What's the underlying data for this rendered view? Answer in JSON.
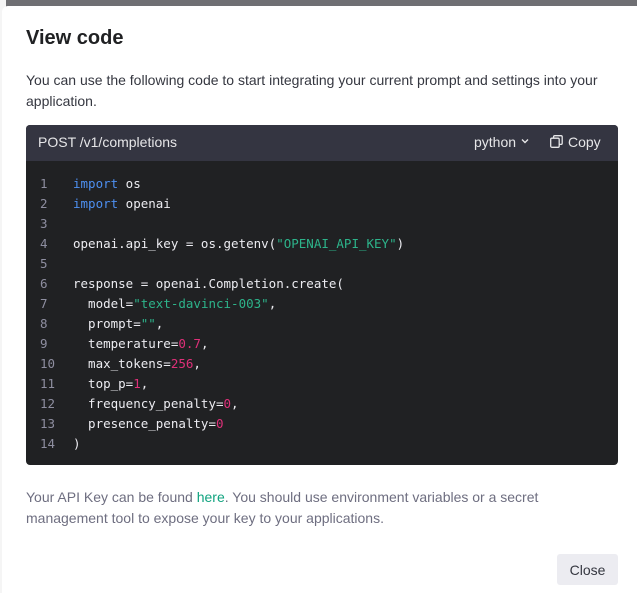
{
  "modal": {
    "title": "View code",
    "intro": "You can use the following code to start integrating your current prompt and settings into your application.",
    "footer_before": "Your API Key can be found ",
    "footer_link": "here",
    "footer_after": ". You should use environment variables or a secret management tool to expose your key to your applications.",
    "close_label": "Close"
  },
  "code_panel": {
    "endpoint": "POST /v1/completions",
    "language": "python",
    "copy_label": "Copy",
    "lines": [
      {
        "n": "1",
        "segs": [
          {
            "t": "import",
            "c": "kw"
          },
          {
            "t": " os",
            "c": ""
          }
        ]
      },
      {
        "n": "2",
        "segs": [
          {
            "t": "import",
            "c": "kw"
          },
          {
            "t": " openai",
            "c": ""
          }
        ]
      },
      {
        "n": "3",
        "segs": []
      },
      {
        "n": "4",
        "segs": [
          {
            "t": "openai.api_key = os.getenv(",
            "c": ""
          },
          {
            "t": "\"OPENAI_API_KEY\"",
            "c": "str"
          },
          {
            "t": ")",
            "c": ""
          }
        ]
      },
      {
        "n": "5",
        "segs": []
      },
      {
        "n": "6",
        "segs": [
          {
            "t": "response = openai.Completion.create(",
            "c": ""
          }
        ]
      },
      {
        "n": "7",
        "segs": [
          {
            "t": "  model=",
            "c": ""
          },
          {
            "t": "\"text-davinci-003\"",
            "c": "str"
          },
          {
            "t": ",",
            "c": ""
          }
        ]
      },
      {
        "n": "8",
        "segs": [
          {
            "t": "  prompt=",
            "c": ""
          },
          {
            "t": "\"\"",
            "c": "str"
          },
          {
            "t": ",",
            "c": ""
          }
        ]
      },
      {
        "n": "9",
        "segs": [
          {
            "t": "  temperature=",
            "c": ""
          },
          {
            "t": "0.7",
            "c": "num"
          },
          {
            "t": ",",
            "c": ""
          }
        ]
      },
      {
        "n": "10",
        "segs": [
          {
            "t": "  max_tokens=",
            "c": ""
          },
          {
            "t": "256",
            "c": "num"
          },
          {
            "t": ",",
            "c": ""
          }
        ]
      },
      {
        "n": "11",
        "segs": [
          {
            "t": "  top_p=",
            "c": ""
          },
          {
            "t": "1",
            "c": "num"
          },
          {
            "t": ",",
            "c": ""
          }
        ]
      },
      {
        "n": "12",
        "segs": [
          {
            "t": "  frequency_penalty=",
            "c": ""
          },
          {
            "t": "0",
            "c": "num"
          },
          {
            "t": ",",
            "c": ""
          }
        ]
      },
      {
        "n": "13",
        "segs": [
          {
            "t": "  presence_penalty=",
            "c": ""
          },
          {
            "t": "0",
            "c": "num"
          }
        ]
      },
      {
        "n": "14",
        "segs": [
          {
            "t": ")",
            "c": ""
          }
        ]
      }
    ]
  },
  "colors": {
    "accent": "#10a37f",
    "code_background": "#202123",
    "keyword": "#4d8ff0",
    "string": "#2db38a",
    "number": "#df3079"
  },
  "icons": {
    "language_chevron": "chevron-down-icon",
    "copy": "copy-icon"
  }
}
